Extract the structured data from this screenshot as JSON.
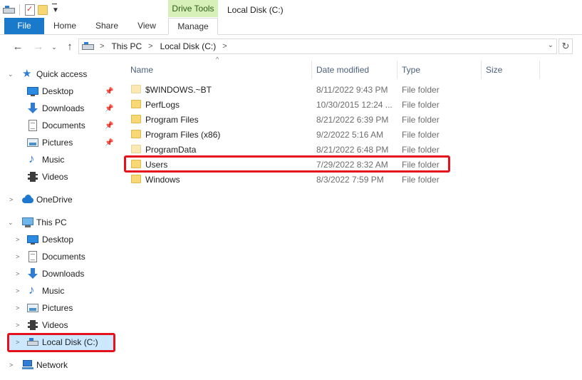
{
  "window": {
    "title": "Local Disk (C:)"
  },
  "ribbon": {
    "context_group": "Drive Tools",
    "tabs": {
      "file": "File",
      "home": "Home",
      "share": "Share",
      "view": "View",
      "manage": "Manage"
    }
  },
  "address": {
    "crumbs": [
      "This PC",
      "Local Disk (C:)"
    ]
  },
  "nav": {
    "quick_access": {
      "label": "Quick access",
      "items": [
        "Desktop",
        "Downloads",
        "Documents",
        "Pictures",
        "Music",
        "Videos"
      ]
    },
    "onedrive": "OneDrive",
    "this_pc": {
      "label": "This PC",
      "items": [
        "Desktop",
        "Documents",
        "Downloads",
        "Music",
        "Pictures",
        "Videos",
        "Local Disk (C:)"
      ]
    },
    "network": "Network"
  },
  "files": {
    "columns": {
      "name": "Name",
      "date": "Date modified",
      "type": "Type",
      "size": "Size"
    },
    "rows": [
      {
        "name": "$WINDOWS.~BT",
        "date": "8/11/2022 9:43 PM",
        "type": "File folder"
      },
      {
        "name": "PerfLogs",
        "date": "10/30/2015 12:24 ...",
        "type": "File folder"
      },
      {
        "name": "Program Files",
        "date": "8/21/2022 6:39 PM",
        "type": "File folder"
      },
      {
        "name": "Program Files (x86)",
        "date": "9/2/2022 5:16 AM",
        "type": "File folder"
      },
      {
        "name": "ProgramData",
        "date": "8/21/2022 6:48 PM",
        "type": "File folder"
      },
      {
        "name": "Users",
        "date": "7/29/2022 8:32 AM",
        "type": "File folder"
      },
      {
        "name": "Windows",
        "date": "8/3/2022 7:59 PM",
        "type": "File folder"
      }
    ]
  },
  "colors": {
    "accent": "#1979ca",
    "highlight": "#e3121c",
    "context_tab": "#d7efb8",
    "nav_selected": "#cce8ff"
  }
}
